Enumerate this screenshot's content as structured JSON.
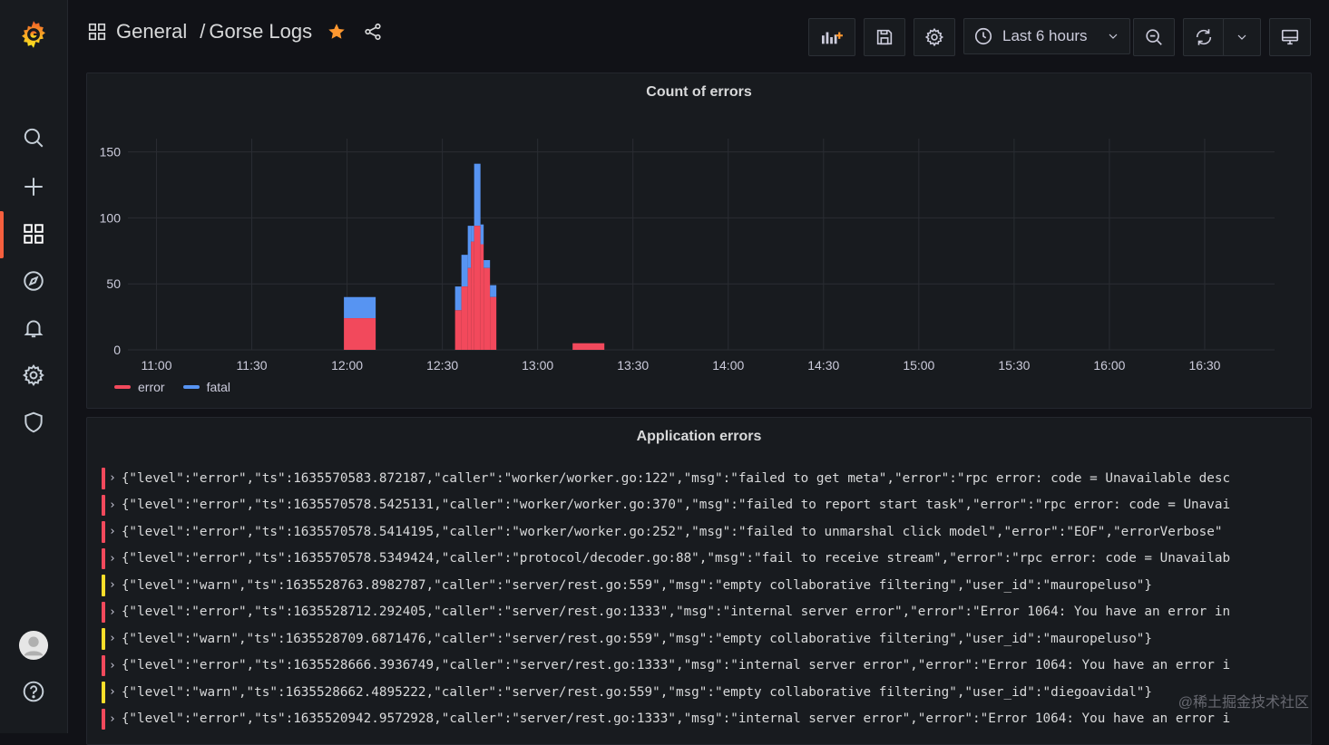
{
  "breadcrumb": {
    "folder": "General",
    "separator": "/",
    "dashboard": "Gorse Logs"
  },
  "toolbar": {
    "time_range": "Last 6 hours",
    "icons": [
      "add-panel-icon",
      "save-icon",
      "settings-icon",
      "clock-icon",
      "chevron-down-icon",
      "zoom-out-icon",
      "refresh-icon",
      "chevron-down-icon",
      "tv-icon"
    ]
  },
  "sidebar": {
    "icons": [
      "grafana-logo-icon",
      "search-icon",
      "plus-icon",
      "dashboards-icon",
      "explore-icon",
      "alerting-icon",
      "settings-icon",
      "shield-icon",
      "avatar",
      "help-icon"
    ],
    "active": "dashboards-icon"
  },
  "colors": {
    "accent": "#f55f3e",
    "error": "#f2495c",
    "fatal": "#5794f2",
    "warn": "#fade2a",
    "star": "#ff9830"
  },
  "errors_panel": {
    "title": "Count of errors"
  },
  "chart_data": {
    "type": "bar",
    "stacked": true,
    "x_tick_labels": [
      "11:00",
      "11:30",
      "12:00",
      "12:30",
      "13:00",
      "13:30",
      "14:00",
      "14:30",
      "15:00",
      "15:30",
      "16:00",
      "16:30"
    ],
    "y_ticks": [
      0,
      50,
      100,
      150
    ],
    "ylim": [
      0,
      160
    ],
    "grid": true,
    "legend_position": "bottom-left",
    "series": [
      {
        "name": "error",
        "color": "#f2495c",
        "points": [
          {
            "x": "11:59",
            "y": 24
          },
          {
            "x": "12:03",
            "y": 24
          },
          {
            "x": "12:35",
            "y": 30
          },
          {
            "x": "12:37",
            "y": 48
          },
          {
            "x": "12:38",
            "y": 62
          },
          {
            "x": "12:39",
            "y": 82
          },
          {
            "x": "12:41",
            "y": 94
          },
          {
            "x": "12:43",
            "y": 80
          },
          {
            "x": "12:44",
            "y": 62
          },
          {
            "x": "12:46",
            "y": 40
          },
          {
            "x": "13:11",
            "y": 5
          },
          {
            "x": "13:16",
            "y": 5
          }
        ]
      },
      {
        "name": "fatal",
        "color": "#5794f2",
        "points": [
          {
            "x": "11:59",
            "y": 16
          },
          {
            "x": "12:03",
            "y": 16
          },
          {
            "x": "12:35",
            "y": 18
          },
          {
            "x": "12:37",
            "y": 24
          },
          {
            "x": "12:38",
            "y": 32
          },
          {
            "x": "12:39",
            "y": 12
          },
          {
            "x": "12:41",
            "y": 47
          },
          {
            "x": "12:43",
            "y": 15
          },
          {
            "x": "12:44",
            "y": 6
          },
          {
            "x": "12:46",
            "y": 9
          },
          {
            "x": "13:11",
            "y": 0
          },
          {
            "x": "13:16",
            "y": 0
          }
        ]
      }
    ],
    "bars": [
      {
        "start": "11:59",
        "end": "12:09",
        "error": 24,
        "fatal": 16
      },
      {
        "start": "12:34",
        "end": "12:36",
        "error": 30,
        "fatal": 18
      },
      {
        "start": "12:36",
        "end": "12:38",
        "error": 48,
        "fatal": 24
      },
      {
        "start": "12:38",
        "end": "12:39",
        "error": 62,
        "fatal": 32
      },
      {
        "start": "12:39",
        "end": "12:40",
        "error": 82,
        "fatal": 12
      },
      {
        "start": "12:40",
        "end": "12:42",
        "error": 94,
        "fatal": 47
      },
      {
        "start": "12:42",
        "end": "12:43",
        "error": 80,
        "fatal": 15
      },
      {
        "start": "12:43",
        "end": "12:45",
        "error": 62,
        "fatal": 6
      },
      {
        "start": "12:45",
        "end": "12:47",
        "error": 40,
        "fatal": 9
      },
      {
        "start": "13:11",
        "end": "13:21",
        "error": 5,
        "fatal": 0
      }
    ]
  },
  "logs_panel": {
    "title": "Application errors",
    "rows": [
      {
        "level": "error",
        "text": "{\"level\":\"error\",\"ts\":1635570583.872187,\"caller\":\"worker/worker.go:122\",\"msg\":\"failed to get meta\",\"error\":\"rpc error: code = Unavailable desc"
      },
      {
        "level": "error",
        "text": "{\"level\":\"error\",\"ts\":1635570578.5425131,\"caller\":\"worker/worker.go:370\",\"msg\":\"failed to report start task\",\"error\":\"rpc error: code = Unavai"
      },
      {
        "level": "error",
        "text": "{\"level\":\"error\",\"ts\":1635570578.5414195,\"caller\":\"worker/worker.go:252\",\"msg\":\"failed to unmarshal click model\",\"error\":\"EOF\",\"errorVerbose\""
      },
      {
        "level": "error",
        "text": "{\"level\":\"error\",\"ts\":1635570578.5349424,\"caller\":\"protocol/decoder.go:88\",\"msg\":\"fail to receive stream\",\"error\":\"rpc error: code = Unavailab"
      },
      {
        "level": "warn",
        "text": "{\"level\":\"warn\",\"ts\":1635528763.8982787,\"caller\":\"server/rest.go:559\",\"msg\":\"empty collaborative filtering\",\"user_id\":\"mauropeluso\"}"
      },
      {
        "level": "error",
        "text": "{\"level\":\"error\",\"ts\":1635528712.292405,\"caller\":\"server/rest.go:1333\",\"msg\":\"internal server error\",\"error\":\"Error 1064: You have an error in"
      },
      {
        "level": "warn",
        "text": "{\"level\":\"warn\",\"ts\":1635528709.6871476,\"caller\":\"server/rest.go:559\",\"msg\":\"empty collaborative filtering\",\"user_id\":\"mauropeluso\"}"
      },
      {
        "level": "error",
        "text": "{\"level\":\"error\",\"ts\":1635528666.3936749,\"caller\":\"server/rest.go:1333\",\"msg\":\"internal server error\",\"error\":\"Error 1064: You have an error i"
      },
      {
        "level": "warn",
        "text": "{\"level\":\"warn\",\"ts\":1635528662.4895222,\"caller\":\"server/rest.go:559\",\"msg\":\"empty collaborative filtering\",\"user_id\":\"diegoavidal\"}"
      },
      {
        "level": "error",
        "text": "{\"level\":\"error\",\"ts\":1635520942.9572928,\"caller\":\"server/rest.go:1333\",\"msg\":\"internal server error\",\"error\":\"Error 1064: You have an error i"
      }
    ]
  },
  "watermark": "@稀土掘金技术社区"
}
